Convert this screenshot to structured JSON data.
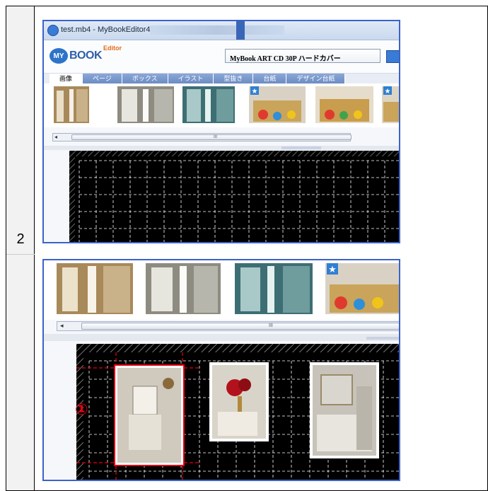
{
  "step": {
    "number": "2"
  },
  "window": {
    "title": "test.mb4 - MyBookEditor4"
  },
  "header": {
    "logo_mark": "MY",
    "logo_book": "BOOK",
    "logo_editor": "Editor",
    "product_select": "MyBook ART CD 30P ハードカバー"
  },
  "tabs": [
    {
      "label": "画像",
      "active": true
    },
    {
      "label": "ページ",
      "active": false
    },
    {
      "label": "ボックス",
      "active": false
    },
    {
      "label": "イラスト",
      "active": false
    },
    {
      "label": "型抜き",
      "active": false
    },
    {
      "label": "台紙",
      "active": false
    },
    {
      "label": "デザイン台紙",
      "active": false
    }
  ],
  "scrollbar": {
    "left_arrow": "◂",
    "grip": "III",
    "splitter_arrow": "▴"
  },
  "thumbnails": [
    {
      "kind": "warm-room"
    },
    {
      "kind": "grey-room"
    },
    {
      "kind": "teal-room"
    },
    {
      "kind": "toys-favorite",
      "favorite": true
    },
    {
      "kind": "toys"
    },
    {
      "kind": "toys-partial",
      "favorite": true
    }
  ],
  "annotation": {
    "marker": "①"
  },
  "colors": {
    "accent": "#3b63c9",
    "marker": "#e60012",
    "grid": "#ffffff",
    "canvas": "#000000"
  }
}
